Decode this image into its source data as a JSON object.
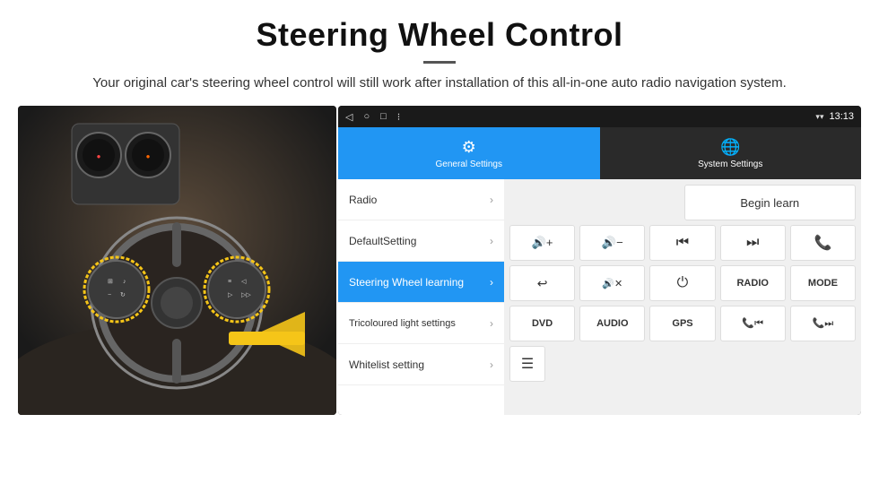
{
  "header": {
    "title": "Steering Wheel Control",
    "subtitle": "Your original car's steering wheel control will still work after installation of this all-in-one auto radio navigation system."
  },
  "status_bar": {
    "time": "13:13",
    "nav_back": "◁",
    "nav_home": "○",
    "nav_recent": "□",
    "nav_dots": "⁝"
  },
  "tabs": [
    {
      "id": "general",
      "label": "General Settings",
      "active": true
    },
    {
      "id": "system",
      "label": "System Settings",
      "active": false
    }
  ],
  "menu_items": [
    {
      "label": "Radio",
      "active": false
    },
    {
      "label": "DefaultSetting",
      "active": false
    },
    {
      "label": "Steering Wheel learning",
      "active": true
    },
    {
      "label": "Tricoloured light settings",
      "active": false
    },
    {
      "label": "Whitelist setting",
      "active": false
    }
  ],
  "controls": {
    "begin_learn_label": "Begin learn",
    "buttons_row2": [
      "🔊+",
      "🔊−",
      "⏮",
      "⏭",
      "📞"
    ],
    "buttons_row3": [
      "↩",
      "🔊✕",
      "⏻",
      "RADIO",
      "MODE"
    ],
    "buttons_row4": [
      "DVD",
      "AUDIO",
      "GPS",
      "📞⏮",
      "📞⏭"
    ],
    "buttons_row5_icon": "☰"
  }
}
